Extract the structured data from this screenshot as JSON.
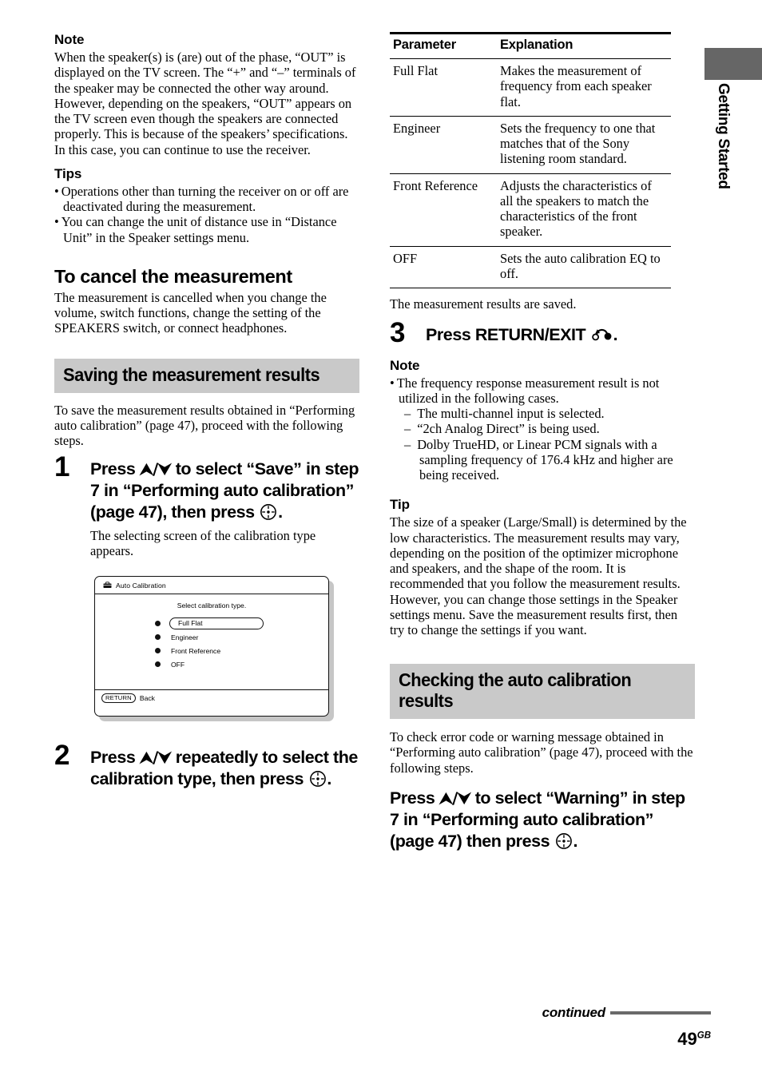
{
  "side_tab": {
    "label": "Getting Started"
  },
  "left": {
    "note_heading": "Note",
    "note_body": "When the speaker(s) is (are) out of the phase, “OUT” is displayed on the TV screen. The “+” and “–” terminals of the speaker may be connected the other way around. However, depending on the speakers, “OUT” appears on the TV screen even though the speakers are connected properly. This is because of the speakers’ specifications. In this case, you can continue to use the receiver.",
    "tips_heading": "Tips",
    "tips": [
      "Operations other than turning the receiver on or off are deactivated during the measurement.",
      "You can change the unit of distance use in “Distance Unit” in the Speaker settings menu."
    ],
    "cancel_heading": "To cancel the measurement",
    "cancel_body": "The measurement is cancelled when you change the volume, switch functions, change the setting of the SPEAKERS switch, or connect headphones.",
    "banner": "Saving the measurement results",
    "intro": "To save the measurement results obtained in “Performing auto calibration” (page 47), proceed with the following steps.",
    "step1": {
      "number": "1",
      "text_a": "Press ",
      "arrows": "⮝/⮟",
      "text_b": " to select “Save” in step 7 in “Performing auto calibration” (page 47), then press ",
      "text_c": ".",
      "body": "The selecting screen of the calibration type appears."
    },
    "screen": {
      "title": "Auto Calibration",
      "prompt": "Select calibration type.",
      "options": [
        "Full Flat",
        "Engineer",
        "Front Reference",
        "OFF"
      ],
      "selected": "Full Flat",
      "footer_key": "RETURN",
      "footer_label": "Back"
    },
    "step2": {
      "number": "2",
      "text_a": "Press ",
      "arrows": "⮝/⮟",
      "text_b": " repeatedly to select the calibration type, then press ",
      "text_c": "."
    }
  },
  "right": {
    "table": {
      "headers": [
        "Parameter",
        "Explanation"
      ],
      "rows": [
        {
          "parameter": "Full Flat",
          "explanation": "Makes the measurement of frequency from each speaker flat."
        },
        {
          "parameter": "Engineer",
          "explanation": "Sets the frequency to one that matches that of the Sony listening room standard."
        },
        {
          "parameter": "Front Reference",
          "explanation": "Adjusts the characteristics of all the speakers to match the characteristics of the front speaker."
        },
        {
          "parameter": "OFF",
          "explanation": "Sets the auto calibration EQ to off."
        }
      ]
    },
    "after_table": "The measurement results are saved.",
    "step3": {
      "number": "3",
      "text_a": "Press RETURN/EXIT ",
      "text_b": "."
    },
    "note_heading": "Note",
    "note_bullet": "The frequency response measurement result is not utilized in the following cases.",
    "note_dashes": [
      "The multi-channel input is selected.",
      "“2ch Analog Direct” is being used.",
      "Dolby TrueHD, or Linear PCM signals with a sampling frequency of 176.4 kHz and higher are being received."
    ],
    "tip_heading": "Tip",
    "tip_body": "The size of a speaker (Large/Small) is determined by the low characteristics. The measurement results may vary, depending on the position of the optimizer microphone and speakers, and the shape of the room. It is recommended that you follow the measurement results. However, you can change those settings in the Speaker settings menu. Save the measurement results first, then try to change the settings if you want.",
    "banner": "Checking the auto calibration\nresults",
    "intro": "To check error code or warning message obtained in “Performing auto calibration” (page 47), proceed with the following steps.",
    "press_step": {
      "text_a": "Press ",
      "arrows": "⮝/⮟",
      "text_b": " to select “Warning” in step 7 in “Performing auto calibration” (page 47) then press ",
      "text_c": "."
    }
  },
  "footer": {
    "continued": "continued",
    "page_number": "49",
    "page_suffix": "GB"
  },
  "colors": {
    "banner_gray": "#c9c9c9",
    "tab_gray": "#666666",
    "rule_gray": "#6a6a6a"
  }
}
